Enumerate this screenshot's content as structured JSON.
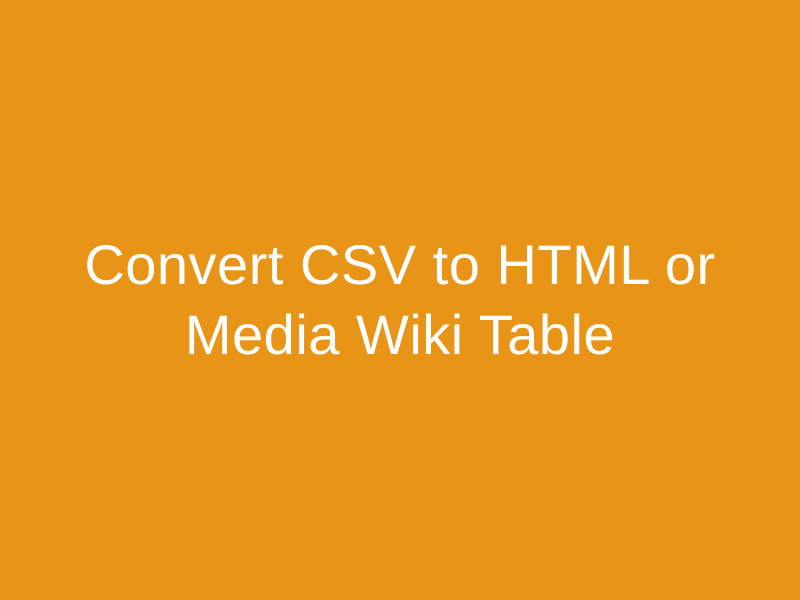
{
  "main": {
    "title": "Convert CSV to HTML or Media Wiki Table"
  }
}
